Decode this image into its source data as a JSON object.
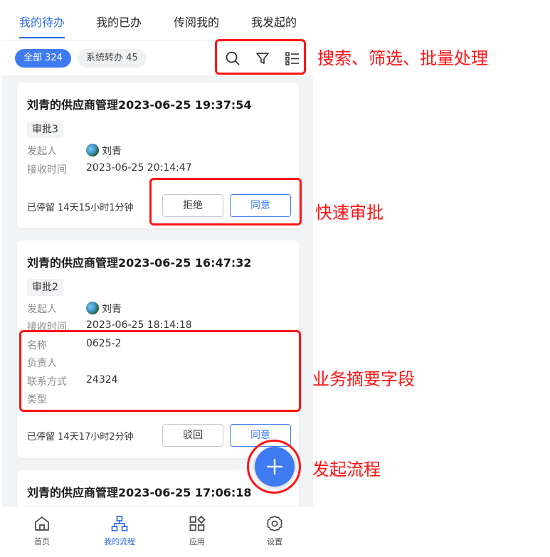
{
  "tabs": [
    "我的待办",
    "我的已办",
    "传阅我的",
    "我发起的"
  ],
  "filters": {
    "all": "全部 324",
    "system": "系统转办 45"
  },
  "cards": [
    {
      "title": "刘青的供应商管理2023-06-25 19:37:54",
      "tag": "审批3",
      "initiator_label": "发起人",
      "initiator": "刘青",
      "received_label": "接收时间",
      "received": "2023-06-25 20:14:47",
      "stay": "已停留 14天15小时1分钟",
      "reject_label": "拒绝",
      "agree_label": "同意"
    },
    {
      "title": "刘青的供应商管理2023-06-25 16:47:32",
      "tag": "审批2",
      "initiator_label": "发起人",
      "initiator": "刘青",
      "received_label": "接收时间",
      "received": "2023-06-25 18:14:18",
      "fields": [
        {
          "label": "名称",
          "value": "0625-2"
        },
        {
          "label": "负责人",
          "value": ""
        },
        {
          "label": "联系方式",
          "value": "24324"
        },
        {
          "label": "类型",
          "value": ""
        }
      ],
      "stay": "已停留 14天17小时2分钟",
      "reject_label": "驳回",
      "agree_label": "同意"
    },
    {
      "title": "刘青的供应商管理2023-06-25 17:06:18"
    }
  ],
  "nav": [
    "首页",
    "我的流程",
    "应用",
    "设置"
  ],
  "annotations": {
    "tools": "搜索、筛选、批量处理",
    "quick_approve": "快速审批",
    "summary_fields": "业务摘要字段",
    "start_flow": "发起流程"
  },
  "icons": {
    "search": "search-icon",
    "filter": "filter-icon",
    "batch": "list-icon",
    "home": "home-icon",
    "flow": "flow-icon",
    "apps": "apps-icon",
    "settings": "gear-icon",
    "plus": "plus-icon"
  },
  "colors": {
    "accent": "#3e7bf0",
    "annotation": "#ff1414",
    "background": "#f2f3f5"
  }
}
